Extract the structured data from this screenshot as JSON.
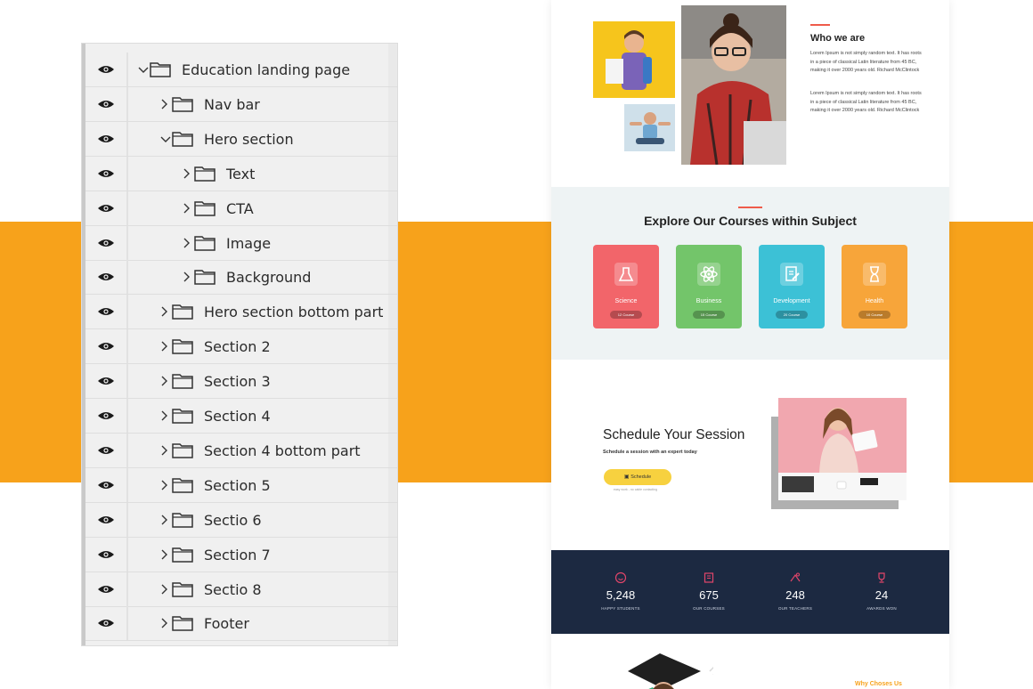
{
  "layers": [
    {
      "label": "Education landing page",
      "depth": 0,
      "expanded": true
    },
    {
      "label": "Nav bar",
      "depth": 1,
      "expanded": false
    },
    {
      "label": "Hero section",
      "depth": 1,
      "expanded": true
    },
    {
      "label": "Text",
      "depth": 2,
      "expanded": false
    },
    {
      "label": "CTA",
      "depth": 2,
      "expanded": false
    },
    {
      "label": "Image",
      "depth": 2,
      "expanded": false
    },
    {
      "label": "Background",
      "depth": 2,
      "expanded": false
    },
    {
      "label": "Hero section bottom part",
      "depth": 1,
      "expanded": false
    },
    {
      "label": "Section 2",
      "depth": 1,
      "expanded": false
    },
    {
      "label": "Section 3",
      "depth": 1,
      "expanded": false
    },
    {
      "label": "Section 4",
      "depth": 1,
      "expanded": false
    },
    {
      "label": "Section 4 bottom part",
      "depth": 1,
      "expanded": false
    },
    {
      "label": "Section 5",
      "depth": 1,
      "expanded": false
    },
    {
      "label": "Sectio 6",
      "depth": 1,
      "expanded": false
    },
    {
      "label": "Section 7",
      "depth": 1,
      "expanded": false
    },
    {
      "label": "Sectio 8",
      "depth": 1,
      "expanded": false
    },
    {
      "label": "Footer",
      "depth": 1,
      "expanded": false
    }
  ],
  "site": {
    "who": {
      "title": "Who we are",
      "p1": "Lorem Ipsum is not simply random text. It has roots in a piece of classical Latin literature from 45 BC, making it over 2000 years old. Richard McClintock",
      "p2": "Lorem Ipsum is not simply random text. It has roots in a piece of classical Latin literature from 45 BC, making it over 2000 years old. Richard McClintock"
    },
    "courses": {
      "title": "Explore Our Courses within Subject",
      "items": [
        {
          "name": "Science",
          "count": "12 Course",
          "color": "#f2656a"
        },
        {
          "name": "Business",
          "count": "15 Course",
          "color": "#73c56a"
        },
        {
          "name": "Development",
          "count": "20 Course",
          "color": "#3cc1d6"
        },
        {
          "name": "Health",
          "count": "10 Course",
          "color": "#f7a53a"
        }
      ]
    },
    "schedule": {
      "title": "Schedule Your Session",
      "subtitle": "Schedule a session with an expert today",
      "button": "Schedule",
      "note": "easy work - no cable contacting"
    },
    "stats": [
      {
        "value": "5,248",
        "label": "HAPPY STUDENTS"
      },
      {
        "value": "675",
        "label": "OUR COURSES"
      },
      {
        "value": "248",
        "label": "OUR TEACHERS"
      },
      {
        "value": "24",
        "label": "AWARDS WON"
      }
    ],
    "why": {
      "title": "Why Choses Us"
    }
  },
  "colors": {
    "band": "#f7a21b",
    "accent": "#ef5b4a",
    "stats_bg": "#1c2941",
    "stats_icon": "#e2456a"
  }
}
